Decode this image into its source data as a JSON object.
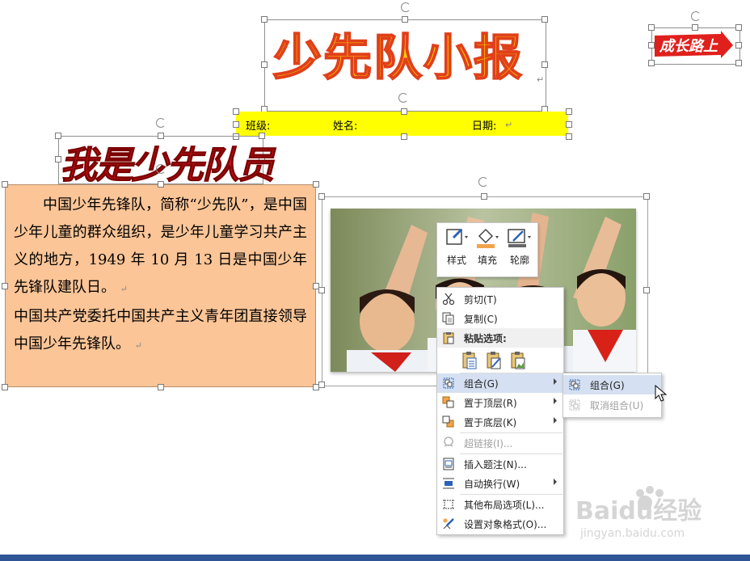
{
  "document": {
    "title": "少先队小报",
    "info_bar": {
      "class_label": "班级:",
      "name_label": "姓名:",
      "date_label": "日期:"
    },
    "return_mark": "↵",
    "growth_badge": "成长路上",
    "calligraphy_title": "我是少先队员",
    "intro_paragraph_1": "中国少年先锋队，简称“少先队”，是中国少年儿童的群众组织，是少年儿童学习共产主义的地方，1949 年 10 月 13 日是中国少年先锋队建队日。",
    "intro_paragraph_2": "中国共产党委托中国共产主义青年团直接领导中国少年先锋队。"
  },
  "mini_toolbar": {
    "style_label": "样式",
    "fill_label": "填充",
    "outline_label": "轮廓"
  },
  "context_menu": {
    "cut": "剪切(T)",
    "copy": "复制(C)",
    "paste_options": "粘贴选项:",
    "group": "组合(G)",
    "bring_to_front": "置于顶层(R)",
    "send_to_back": "置于底层(K)",
    "hyperlink": "超链接(I)...",
    "insert_caption": "插入题注(N)...",
    "wrap_text": "自动换行(W)",
    "more_layout": "其他布局选项(L)...",
    "format_object": "设置对象格式(O)..."
  },
  "submenu": {
    "group": "组合(G)",
    "ungroup": "取消组合(U)"
  },
  "watermark": {
    "brand": "Baidu经验",
    "url": "jingyan.baidu.com"
  },
  "colors": {
    "title_fill": "#ffd200",
    "title_stroke": "#e0401a",
    "info_bar": "#ffff00",
    "intro_box": "#fbc597",
    "menu_highlight": "#d5e1f2",
    "bottom_strip": "#2f5597"
  }
}
